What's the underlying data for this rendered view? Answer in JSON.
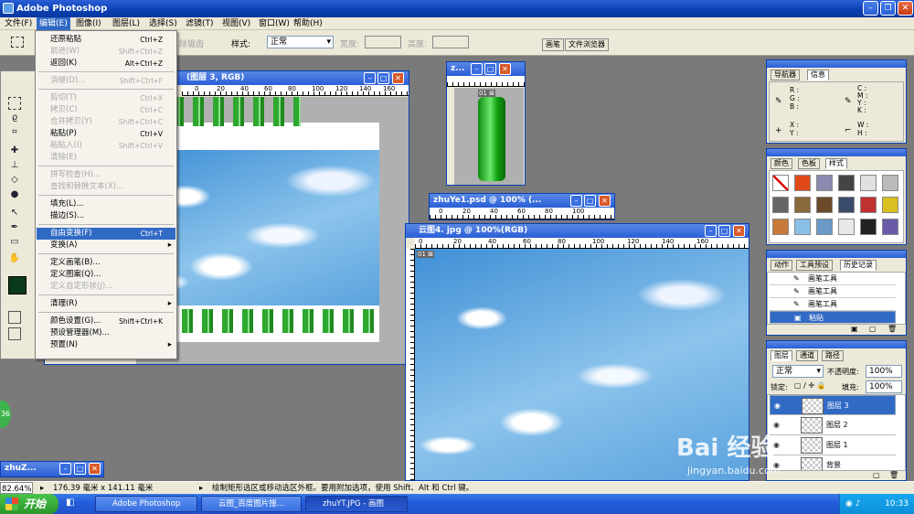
{
  "app": {
    "title": "Adobe Photoshop"
  },
  "menubar": {
    "items": [
      "文件(F)",
      "编辑(E)",
      "图像(I)",
      "图层(L)",
      "选择(S)",
      "滤镜(T)",
      "视图(V)",
      "窗口(W)",
      "帮助(H)"
    ]
  },
  "options": {
    "feather_label": "除锯齿",
    "style_label": "样式:",
    "style_value": "正常",
    "width_label": "宽度:",
    "height_label": "高度:",
    "well_tabs": [
      "画笔",
      "文件浏览器"
    ]
  },
  "edit_menu": [
    {
      "label": "还原粘贴",
      "shortcut": "Ctrl+Z",
      "disabled": false
    },
    {
      "label": "前进(W)",
      "shortcut": "Shift+Ctrl+Z",
      "disabled": true
    },
    {
      "label": "返回(K)",
      "shortcut": "Alt+Ctrl+Z",
      "disabled": false
    },
    {
      "sep": true
    },
    {
      "label": "消褪(D)...",
      "shortcut": "Shift+Ctrl+F",
      "disabled": true
    },
    {
      "sep": true
    },
    {
      "label": "剪切(T)",
      "shortcut": "Ctrl+X",
      "disabled": true
    },
    {
      "label": "拷贝(C)",
      "shortcut": "Ctrl+C",
      "disabled": true
    },
    {
      "label": "合并拷贝(Y)",
      "shortcut": "Shift+Ctrl+C",
      "disabled": true
    },
    {
      "label": "粘贴(P)",
      "shortcut": "Ctrl+V",
      "disabled": false
    },
    {
      "label": "粘贴入(I)",
      "shortcut": "Shift+Ctrl+V",
      "disabled": true
    },
    {
      "label": "清除(E)",
      "shortcut": "",
      "disabled": true
    },
    {
      "sep": true
    },
    {
      "label": "拼写检查(H)...",
      "shortcut": "",
      "disabled": true
    },
    {
      "label": "查找和替换文本(X)...",
      "shortcut": "",
      "disabled": true
    },
    {
      "sep": true
    },
    {
      "label": "填充(L)...",
      "shortcut": "",
      "disabled": false
    },
    {
      "label": "描边(S)...",
      "shortcut": "",
      "disabled": false
    },
    {
      "sep": true
    },
    {
      "label": "自由变换(F)",
      "shortcut": "Ctrl+T",
      "disabled": false,
      "highlight": true
    },
    {
      "label": "变换(A)",
      "shortcut": "",
      "disabled": false,
      "submenu": true
    },
    {
      "sep": true
    },
    {
      "label": "定义画笔(B)...",
      "shortcut": "",
      "disabled": false
    },
    {
      "label": "定义图案(Q)...",
      "shortcut": "",
      "disabled": false
    },
    {
      "label": "定义自定形状(J)...",
      "shortcut": "",
      "disabled": true
    },
    {
      "sep": true
    },
    {
      "label": "清理(R)",
      "shortcut": "",
      "disabled": false,
      "submenu": true
    },
    {
      "sep": true
    },
    {
      "label": "颜色设置(G)...",
      "shortcut": "Shift+Ctrl+K",
      "disabled": false
    },
    {
      "label": "预设管理器(M)...",
      "shortcut": "",
      "disabled": false
    },
    {
      "label": "预置(N)",
      "shortcut": "",
      "disabled": false,
      "submenu": true
    }
  ],
  "documents": {
    "main": {
      "title": "(图层 3, RGB)",
      "ruler": [
        "0",
        "20",
        "40",
        "60",
        "80",
        "100",
        "120",
        "140",
        "160"
      ]
    },
    "small": {
      "title": "z...",
      "tag": "01 ⊠"
    },
    "zhuye": {
      "title": "zhuYe1.psd @ 100% (...",
      "ruler": [
        "0",
        "20",
        "40",
        "60",
        "80",
        "100"
      ]
    },
    "cloud": {
      "title": "云图4. jpg @ 100%(RGB)",
      "ruler": [
        "0",
        "20",
        "40",
        "60",
        "80",
        "100",
        "120",
        "140",
        "160"
      ],
      "tag": "01 ⊠"
    },
    "minimized": {
      "title": "zhuZ..."
    }
  },
  "panels": {
    "info": {
      "tabs": [
        "导航器",
        "信息"
      ],
      "rgb": [
        "R :",
        "G :",
        "B :"
      ],
      "cmyk": [
        "C :",
        "M :",
        "Y :",
        "K :"
      ],
      "xy": [
        "X :",
        "Y :"
      ],
      "wh": [
        "W :",
        "H :"
      ]
    },
    "swatches": {
      "tabs": [
        "颜色",
        "色板",
        "样式"
      ]
    },
    "history": {
      "tabs": [
        "动作",
        "工具预设",
        "历史记录"
      ],
      "items": [
        {
          "label": "画笔工具",
          "selected": false
        },
        {
          "label": "画笔工具",
          "selected": false
        },
        {
          "label": "画笔工具",
          "selected": false
        },
        {
          "label": "粘贴",
          "selected": true
        }
      ]
    },
    "layers": {
      "tabs": [
        "图层",
        "通道",
        "路径"
      ],
      "blend": "正常",
      "opacity_label": "不透明度:",
      "opacity": "100%",
      "lock_label": "锁定:",
      "fill_label": "填充:",
      "fill": "100%",
      "items": [
        {
          "label": "图层 3",
          "selected": true
        },
        {
          "label": "图层 2",
          "selected": false
        },
        {
          "label": "图层 1",
          "selected": false
        },
        {
          "label": "背景",
          "selected": false
        }
      ]
    }
  },
  "status": {
    "zoom": "82.64%",
    "doc_size": "176.39 毫米 x 141.11 毫米",
    "hint": "绘制矩形选区或移动选区外框。要用附加选项，使用 Shift、Alt 和 Ctrl 键。"
  },
  "taskbar": {
    "start": "开始",
    "tasks": [
      "Adobe Photoshop",
      "云图_百度图片搜...",
      "zhuYT.JPG - 画图"
    ],
    "clock": "10:33"
  },
  "watermark": {
    "brand": "Bai 经验",
    "url": "jingyan.baidu.com"
  },
  "side_badge": "36"
}
